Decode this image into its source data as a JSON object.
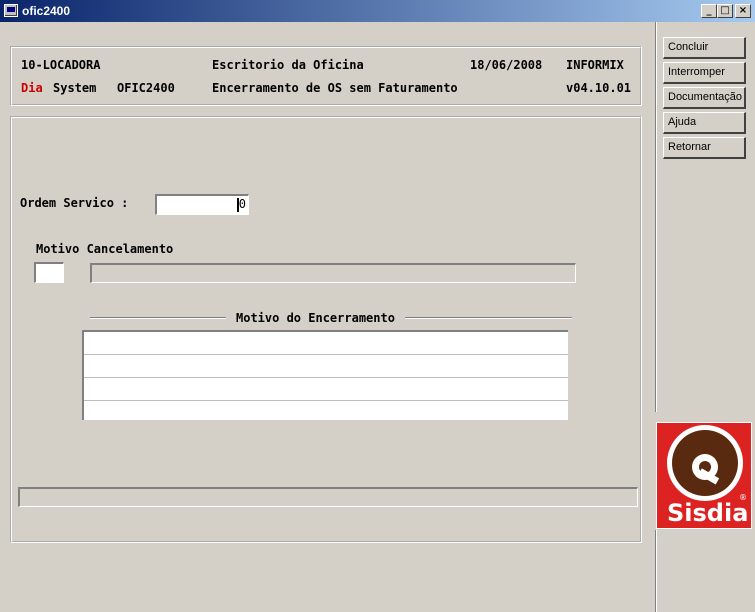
{
  "window": {
    "title": "ofic2400",
    "minimize_glyph": "_",
    "maximize_glyph": "□",
    "close_glyph": "×"
  },
  "header": {
    "company": "10-LOCADORA",
    "module": "Escritorio da Oficina",
    "date": "18/06/2008",
    "database": "INFORMIX",
    "brand_red": "Dia",
    "brand_rest": "System",
    "program": "OFIC2400",
    "screen_title": "Encerramento de OS sem Faturamento",
    "version": "v04.10.01"
  },
  "form": {
    "ordem_label": "Ordem Servico :",
    "ordem_value": "0",
    "motivo_cancel_label": "Motivo Cancelamento",
    "motivo_code": "",
    "motivo_desc": "",
    "encerramento_title": "Motivo do Encerramento",
    "encerramento_rows": [
      "",
      "",
      "",
      ""
    ],
    "status_text": ""
  },
  "side_buttons": [
    "Concluir",
    "Interromper",
    "Documentação",
    "Ajuda",
    "Retornar"
  ],
  "logo": {
    "text": "Sisdia",
    "mark": "®",
    "color": "#dd2222"
  },
  "colors": {
    "titlebar": "#0a246a",
    "brand_red": "#cc0000",
    "background": "#d4d0c8"
  }
}
